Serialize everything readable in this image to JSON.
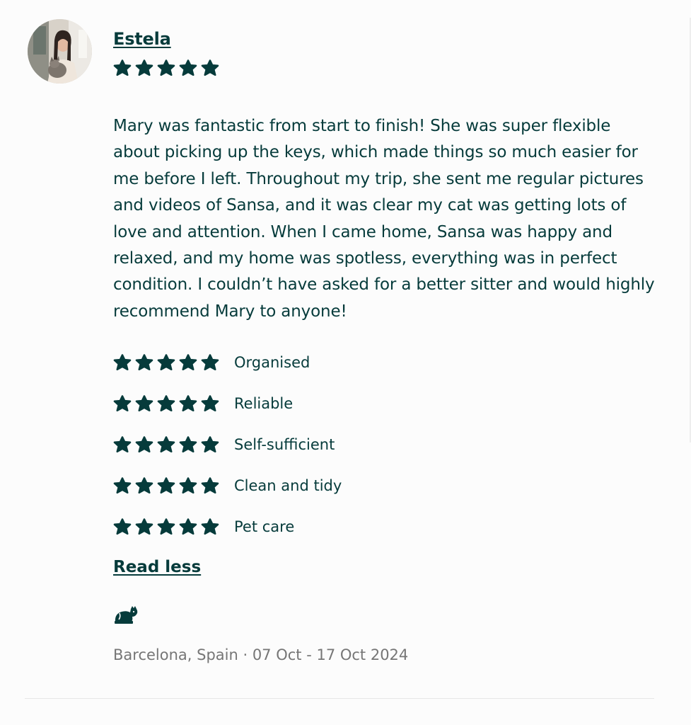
{
  "review": {
    "reviewer_name": "Estela",
    "overall_rating": 5,
    "text": "Mary was fantastic from start to finish! She was super flexible about picking up the keys, which made things so much easier for me before I left. Throughout my trip, she sent me regular pictures and videos of Sansa, and it was clear my cat was getting lots of love and attention. When I came home, Sansa was happy and relaxed, and my home was spotless, everything was in perfect condition. I couldn’t have asked for a better sitter and would highly recommend Mary to anyone!",
    "ratings": [
      {
        "label": "Organised",
        "stars": 5
      },
      {
        "label": "Reliable",
        "stars": 5
      },
      {
        "label": "Self-sufficient",
        "stars": 5
      },
      {
        "label": "Clean and tidy",
        "stars": 5
      },
      {
        "label": "Pet care",
        "stars": 5
      }
    ],
    "read_less_label": "Read less",
    "pet_icon": "cat-icon",
    "meta": "Barcelona, Spain · 07 Oct - 17 Oct 2024"
  },
  "colors": {
    "primary": "#063b3b",
    "muted": "#767676",
    "background": "#fcfcfc",
    "divider": "#e7e7e7"
  }
}
